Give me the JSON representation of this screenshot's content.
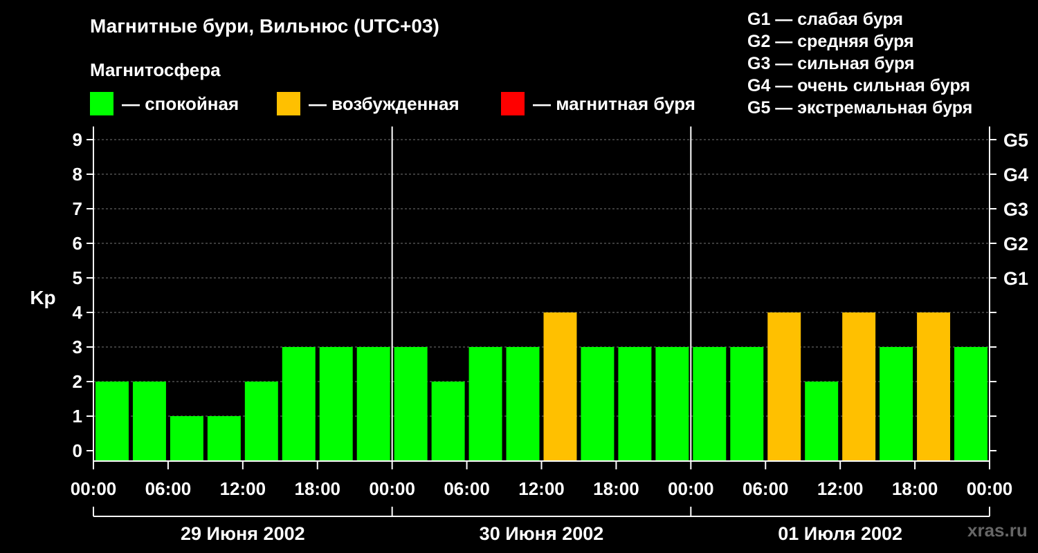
{
  "title": "Магнитные бури, Вильнюс (UTC+03)",
  "subtitle": "Магнитосфера",
  "legend": [
    {
      "label": "— спокойная",
      "color": "#00ff00"
    },
    {
      "label": "— возбужденная",
      "color": "#ffc000"
    },
    {
      "label": "— магнитная буря",
      "color": "#ff0000"
    }
  ],
  "g_legend": [
    "G1 — слабая буря",
    "G2 — средняя буря",
    "G3 — сильная буря",
    "G4 — очень сильная буря",
    "G5 — экстремальная буря"
  ],
  "watermark": "xras.ru",
  "chart_data": {
    "type": "bar",
    "ylabel": "Kp",
    "ylim": [
      0,
      9
    ],
    "y_ticks": [
      "0",
      "1",
      "2",
      "3",
      "4",
      "5",
      "6",
      "7",
      "8",
      "9"
    ],
    "right_ticks": [
      {
        "value": 5,
        "label": "G1"
      },
      {
        "value": 6,
        "label": "G2"
      },
      {
        "value": 7,
        "label": "G3"
      },
      {
        "value": 8,
        "label": "G4"
      },
      {
        "value": 9,
        "label": "G5"
      }
    ],
    "x_tick_labels": [
      "00:00",
      "06:00",
      "12:00",
      "18:00",
      "00:00",
      "06:00",
      "12:00",
      "18:00",
      "00:00",
      "06:00",
      "12:00",
      "18:00",
      "00:00"
    ],
    "dates": [
      "29 Июня 2002",
      "30 Июня 2002",
      "01 Июля 2002"
    ],
    "interval_hours": 3,
    "values": [
      2,
      2,
      1,
      1,
      2,
      3,
      3,
      3,
      3,
      2,
      3,
      3,
      4,
      3,
      3,
      3,
      3,
      3,
      4,
      2,
      4,
      3,
      4,
      3
    ],
    "status": [
      "calm",
      "calm",
      "calm",
      "calm",
      "calm",
      "calm",
      "calm",
      "calm",
      "calm",
      "calm",
      "calm",
      "calm",
      "excited",
      "calm",
      "calm",
      "calm",
      "calm",
      "calm",
      "excited",
      "calm",
      "excited",
      "calm",
      "excited",
      "calm"
    ],
    "colors": {
      "calm": "#00ff00",
      "excited": "#ffc000",
      "storm": "#ff0000"
    },
    "grid": "dashed horizontal"
  }
}
